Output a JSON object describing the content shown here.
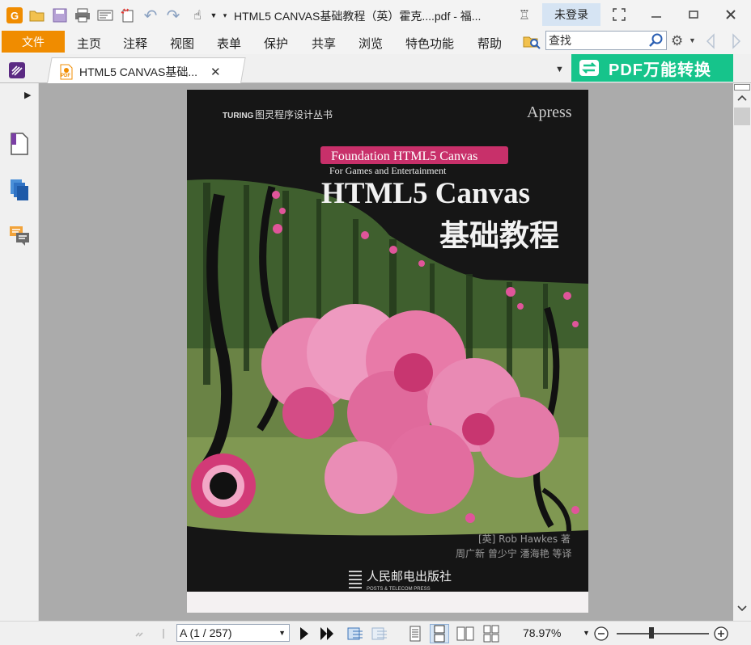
{
  "window": {
    "title": "HTML5 CANVAS基础教程（英）霍克....pdf - 福...",
    "login_label": "未登录",
    "app_logo": "G"
  },
  "menu": {
    "file": "文件",
    "items": [
      "主页",
      "注释",
      "视图",
      "表单",
      "保护",
      "共享",
      "浏览",
      "特色功能",
      "帮助"
    ],
    "search_placeholder": "查找"
  },
  "tabs": {
    "active_label": "HTML5 CANVAS基础...",
    "pdf_badge": "PDF",
    "banner_label": "PDF万能转换"
  },
  "cover": {
    "series_brand": "TURING",
    "series_name": "图灵程序设计丛书",
    "publisher_brand": "Apress",
    "ribbon_title": "Foundation HTML5 Canvas",
    "subtitle_en": "For Games and Entertainment",
    "title_main": "HTML5 Canvas",
    "title_cn": "基础教程",
    "author_line": "[英]  Rob Hawkes  著",
    "translator_line": "周广新  曾少宁  潘海艳  等译",
    "press_cn": "人民邮电出版社",
    "press_en": "POSTS & TELECOM PRESS"
  },
  "statusbar": {
    "page_indicator": "A (1 / 257)",
    "zoom": "78.97%"
  },
  "colors": {
    "accent_orange": "#f08c00",
    "banner_green": "#16c48b",
    "ribbon_pink": "#c8306a",
    "orchid_pink": "#e86aa0"
  }
}
